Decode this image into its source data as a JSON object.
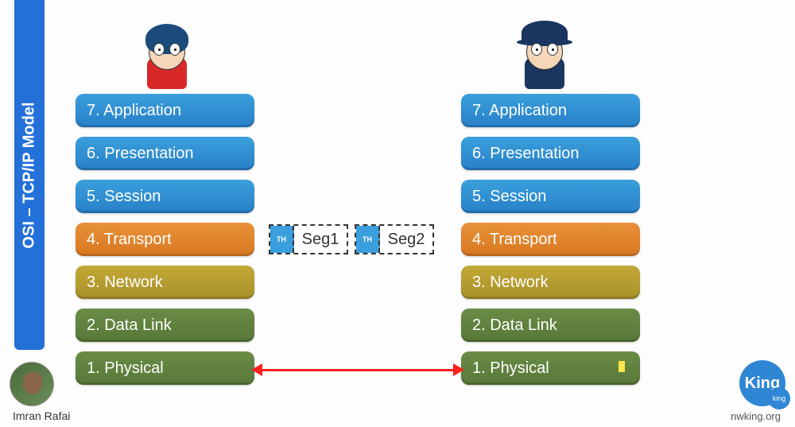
{
  "sidebar": {
    "title": "OSI – TCP/IP Model"
  },
  "layers_left": [
    {
      "label": "7. Application",
      "color": "blue"
    },
    {
      "label": "6. Presentation",
      "color": "blue"
    },
    {
      "label": "5. Session",
      "color": "blue"
    },
    {
      "label": "4. Transport",
      "color": "orange"
    },
    {
      "label": "3. Network",
      "color": "olive"
    },
    {
      "label": "2. Data Link",
      "color": "green"
    },
    {
      "label": "1. Physical",
      "color": "green"
    }
  ],
  "layers_right": [
    {
      "label": "7. Application",
      "color": "blue"
    },
    {
      "label": "6. Presentation",
      "color": "blue"
    },
    {
      "label": "5. Session",
      "color": "blue"
    },
    {
      "label": "4. Transport",
      "color": "orange"
    },
    {
      "label": "3. Network",
      "color": "olive"
    },
    {
      "label": "2. Data Link",
      "color": "green"
    },
    {
      "label": "1. Physical",
      "color": "green"
    }
  ],
  "segments": [
    {
      "header": "TH",
      "label": "Seg1"
    },
    {
      "header": "TH",
      "label": "Seg2"
    }
  ],
  "author": {
    "name": "Imran Rafai"
  },
  "brand": {
    "logo": "King",
    "sub": "king",
    "site": "nwking.org"
  },
  "characters": {
    "left": {
      "hair_color": "#1a4b7a",
      "shirt_color": "#d82828"
    },
    "right": {
      "hat_color": "#1a3560",
      "shirt_color": "#1a3560"
    }
  }
}
